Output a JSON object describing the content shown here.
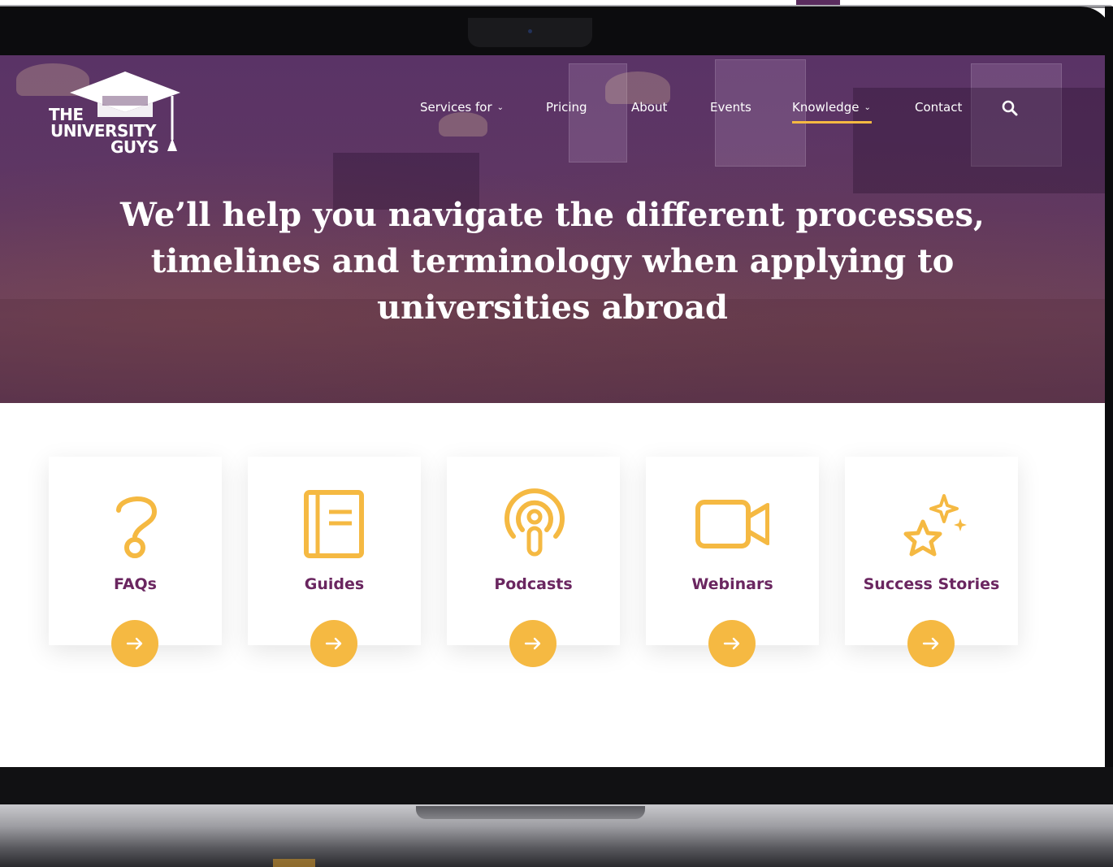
{
  "brand": {
    "logo_line1": "THE",
    "logo_line2": "UNIVERSITY",
    "logo_line3": "GUYS",
    "accent_color": "#f5b942",
    "primary_color": "#6a2660"
  },
  "nav": {
    "items": [
      {
        "label": "Services for",
        "has_dropdown": true
      },
      {
        "label": "Pricing",
        "has_dropdown": false
      },
      {
        "label": "About",
        "has_dropdown": false
      },
      {
        "label": "Events",
        "has_dropdown": false
      },
      {
        "label": "Knowledge",
        "has_dropdown": true,
        "active": true
      },
      {
        "label": "Contact",
        "has_dropdown": false
      }
    ],
    "search_icon": "search-icon"
  },
  "hero": {
    "headline_line1": "We’ll help you navigate the different processes,",
    "headline_line2": "timelines and terminology when applying to",
    "headline_line3": "universities abroad"
  },
  "cards": [
    {
      "label": "FAQs",
      "icon": "question-mark-icon"
    },
    {
      "label": "Guides",
      "icon": "book-icon"
    },
    {
      "label": "Podcasts",
      "icon": "podcast-icon"
    },
    {
      "label": "Webinars",
      "icon": "video-camera-icon"
    },
    {
      "label": "Success Stories",
      "icon": "star-sparkle-icon"
    }
  ]
}
